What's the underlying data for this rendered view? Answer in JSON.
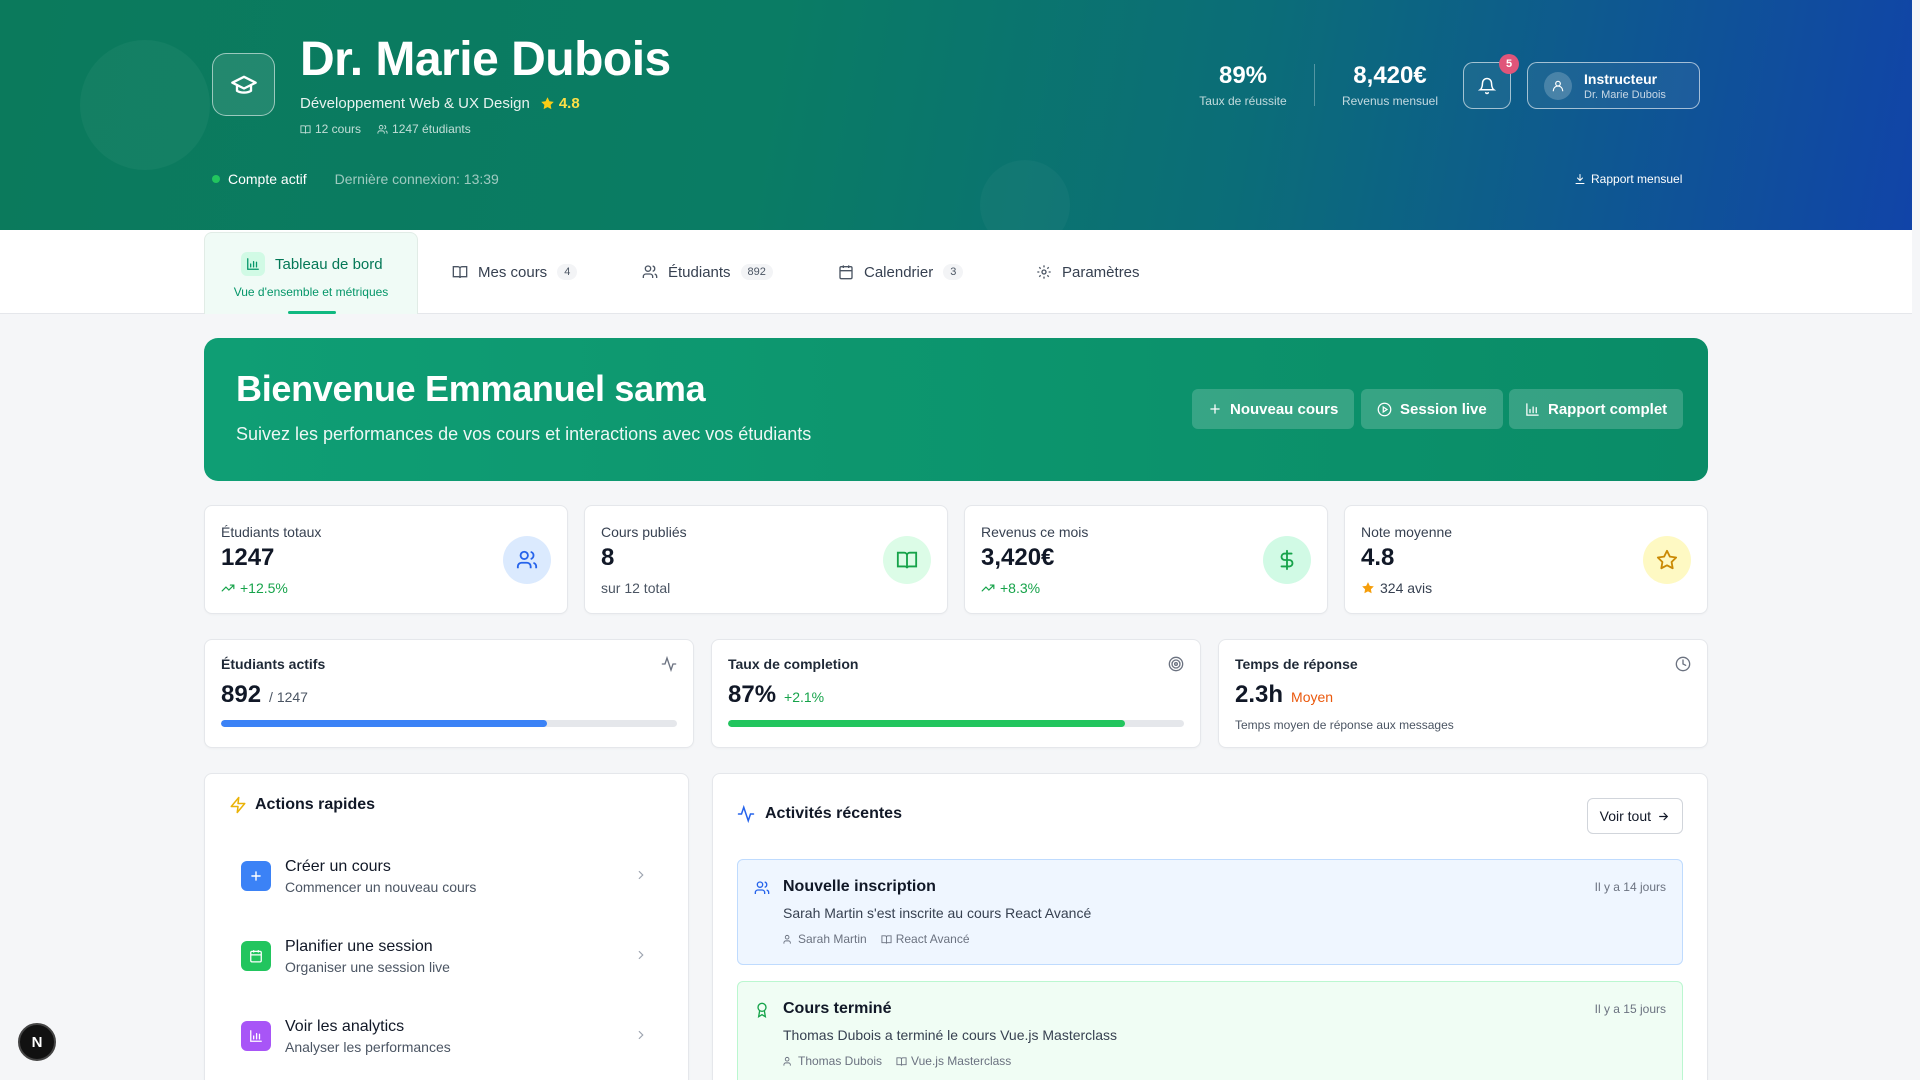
{
  "header": {
    "name": "Dr. Marie Dubois",
    "specialty": "Développement Web & UX Design",
    "rating": "4.8",
    "courses": "12 cours",
    "students": "1247 étudiants",
    "status": "Compte actif",
    "last_login": "Dernière connexion: 13:39",
    "stats": [
      {
        "value": "89%",
        "label": "Taux de réussite"
      },
      {
        "value": "8,420€",
        "label": "Revenus mensuel"
      }
    ],
    "notif_count": "5",
    "user_role": "Instructeur",
    "user_name": "Dr. Marie Dubois",
    "report_link": "Rapport mensuel"
  },
  "tabs": {
    "active": {
      "label": "Tableau de bord",
      "sub": "Vue d'ensemble et métriques"
    },
    "items": [
      {
        "label": "Mes cours",
        "count": "4"
      },
      {
        "label": "Étudiants",
        "count": "892"
      },
      {
        "label": "Calendrier",
        "count": "3"
      },
      {
        "label": "Paramètres"
      }
    ]
  },
  "welcome": {
    "title": "Bienvenue Emmanuel sama",
    "subtitle": "Suivez les performances de vos cours et interactions avec vos étudiants",
    "buttons": [
      "Nouveau cours",
      "Session live",
      "Rapport complet"
    ]
  },
  "stat_cards": [
    {
      "label": "Étudiants totaux",
      "value": "1247",
      "sub": "+12.5%",
      "icon": "users-icon",
      "color": "#2563eb"
    },
    {
      "label": "Cours publiés",
      "value": "8",
      "sub": "sur 12 total",
      "icon": "book-icon",
      "color": "#16a34a"
    },
    {
      "label": "Revenus ce mois",
      "value": "3,420€",
      "sub": "+8.3%",
      "icon": "dollar-icon",
      "color": "#16a34a"
    },
    {
      "label": "Note moyenne",
      "value": "4.8",
      "sub": "324 avis",
      "icon": "star-icon",
      "color": "#ca8a04"
    }
  ],
  "metrics": {
    "active_students": {
      "label": "Étudiants actifs",
      "value": "892",
      "total": "/ 1247",
      "progress": 0.715
    },
    "completion": {
      "label": "Taux de completion",
      "value": "87%",
      "delta": "+2.1%",
      "progress": 0.87
    },
    "response": {
      "label": "Temps de réponse",
      "value": "2.3h",
      "tag": "Moyen",
      "note": "Temps moyen de réponse aux messages"
    }
  },
  "quick_actions": {
    "title": "Actions rapides",
    "items": [
      {
        "title": "Créer un cours",
        "sub": "Commencer un nouveau cours",
        "color": "#3b82f6"
      },
      {
        "title": "Planifier une session",
        "sub": "Organiser une session live",
        "color": "#22c55e"
      },
      {
        "title": "Voir les analytics",
        "sub": "Analyser les performances",
        "color": "#a855f7"
      }
    ]
  },
  "activities": {
    "title": "Activités récentes",
    "see_all": "Voir tout",
    "items": [
      {
        "title": "Nouvelle inscription",
        "desc": "Sarah Martin s'est inscrite au cours React Avancé",
        "user": "Sarah Martin",
        "course": "React Avancé",
        "time": "Il y a 14 jours"
      },
      {
        "title": "Cours terminé",
        "desc": "Thomas Dubois a terminé le cours Vue.js Masterclass",
        "user": "Thomas Dubois",
        "course": "Vue.js Masterclass",
        "time": "Il y a 15 jours"
      }
    ]
  },
  "corner_badge": "N"
}
